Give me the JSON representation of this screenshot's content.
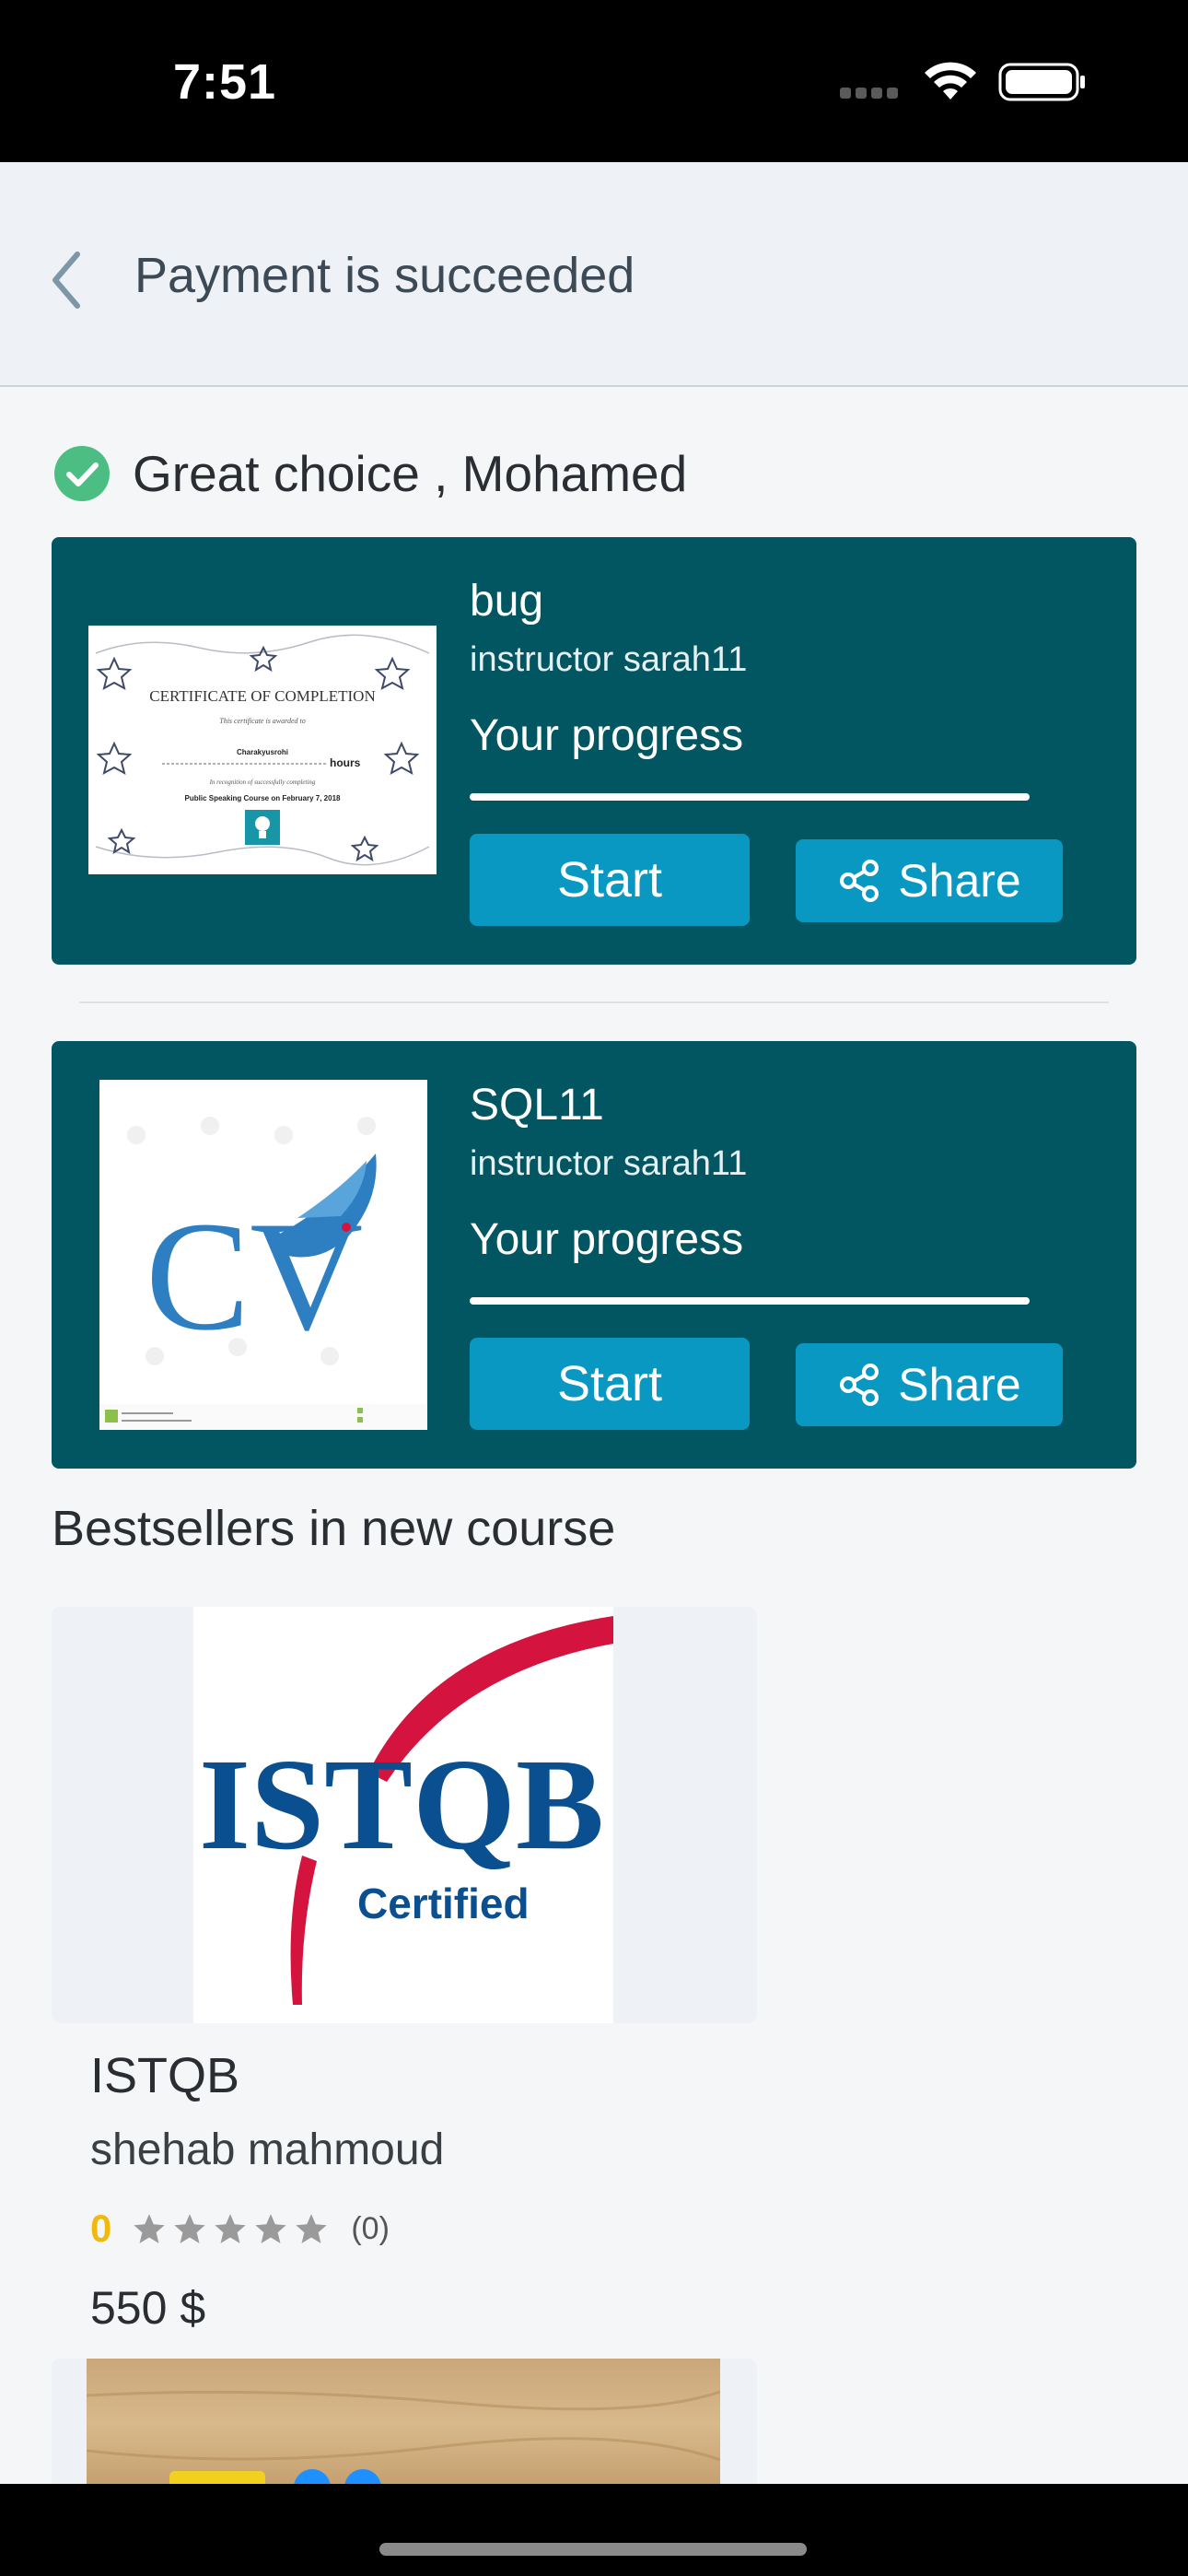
{
  "status_bar": {
    "time": "7:51"
  },
  "header": {
    "title": "Payment is succeeded"
  },
  "success": {
    "message": "Great choice , Mohamed"
  },
  "purchased_courses": [
    {
      "title": "bug",
      "instructor": "instructor sarah11",
      "progress_label": "Your progress",
      "progress": 1.0,
      "start_label": "Start",
      "share_label": "Share",
      "thumbnail": {
        "heading": "CERTIFICATE OF COMPLETION",
        "line1": "This certificate is awarded to",
        "name": "Charakyusrohi",
        "hours": "hours",
        "line2": "In recognition of successfully completing",
        "course": "Public Speaking Course on February 7, 2018"
      }
    },
    {
      "title": "SQL11",
      "instructor": "instructor sarah11",
      "progress_label": "Your progress",
      "progress": 1.0,
      "start_label": "Start",
      "share_label": "Share",
      "thumbnail": {
        "logo_text": "CV"
      }
    }
  ],
  "bestsellers": {
    "section_title": "Bestsellers in new course",
    "items": [
      {
        "image_text": "ISTQB",
        "image_subtext": "Certified",
        "name": "ISTQB",
        "instructor": "shehab mahmoud",
        "rating": "0",
        "stars": 0,
        "rating_count": "(0)",
        "price": "550 $"
      }
    ]
  },
  "colors": {
    "card_bg": "#015662",
    "button_bg": "#0898c2",
    "success_green": "#4cbe84",
    "rating_gold": "#f2b90d",
    "istqb_blue": "#0a4f8f",
    "istqb_red": "#d4143e"
  },
  "icons": [
    "back-arrow-icon",
    "check-circle-icon",
    "share-icon",
    "star-icon",
    "wifi-icon",
    "battery-icon"
  ]
}
